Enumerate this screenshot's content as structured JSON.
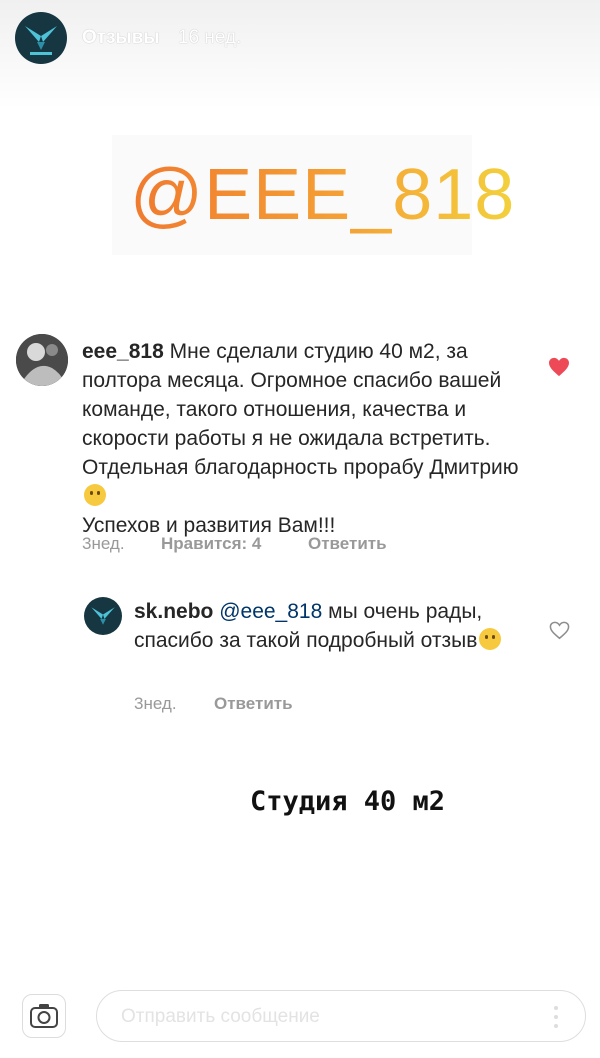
{
  "header": {
    "title": "Отзывы",
    "time": "16 нед.",
    "avatar_icon": "brand-logo-icon"
  },
  "banner": {
    "handle": "@EEE_818",
    "gradient": [
      "#f07a2f",
      "#f4a035",
      "#f3d13d"
    ]
  },
  "comment": {
    "username": "eee_818",
    "text": "Мне сделали студию 40 м2, за полтора месяца. Огромное спасибо вашей команде, такого отношения, качества и скорости работы я не ожидала встретить. Отдельная благодарность прорабу Дмитрию",
    "closing_text": "Успехов и развития Вам!!!",
    "emoji": "smiling-face-emoji",
    "time": "3нед.",
    "likes_label": "Нравится: 4",
    "reply_label": "Ответить",
    "liked": true,
    "like_color": "#ed4956"
  },
  "reply": {
    "username": "sk.nebo",
    "mention": "@eee_818",
    "text": "мы очень рады, спасибо за такой подробный отзыв",
    "emoji": "blushing-face-emoji",
    "time": "3нед.",
    "reply_label": "Ответить",
    "liked": false
  },
  "caption": "Студия 40 м2",
  "footer": {
    "camera_icon": "camera-icon",
    "placeholder": "Отправить сообщение",
    "more_icon": "more-vertical-icon"
  }
}
